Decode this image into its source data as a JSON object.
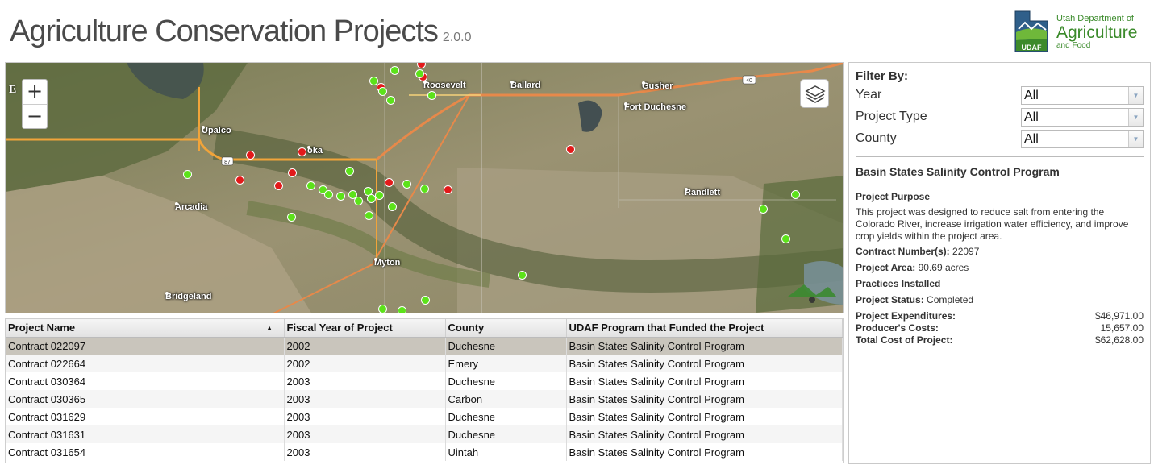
{
  "header": {
    "title": "Agriculture Conservation Projects",
    "version": "2.0.0",
    "logo": {
      "line1": "Utah Department of",
      "line2": "Agriculture",
      "line3": "and Food",
      "badge": "UDAF"
    }
  },
  "map": {
    "zoom_in": "+",
    "zoom_out": "−",
    "edge_letter": "E",
    "places": {
      "roosevelt": "Roosevelt",
      "ballard": "Ballard",
      "gusher": "Gusher",
      "fort_duchesne": "Fort Duchesne",
      "upalco": "Upalco",
      "ioka": "oka",
      "arcadia": "Arcadia",
      "randlett": "Randlett",
      "myton": "Myton",
      "bridgeland": "Bridgeland"
    },
    "road_labels": {
      "hwy87": "87",
      "hwy40": "40"
    },
    "colors": {
      "active_point": "#5ce21a",
      "alert_point": "#e21a1a"
    }
  },
  "table": {
    "columns": [
      "Project Name",
      "Fiscal Year of Project",
      "County",
      "UDAF Program that Funded the Project"
    ],
    "rows": [
      [
        "Contract 022097",
        "2002",
        "Duchesne",
        "Basin States Salinity Control Program"
      ],
      [
        "Contract 022664",
        "2002",
        "Emery",
        "Basin States Salinity Control Program"
      ],
      [
        "Contract 030364",
        "2003",
        "Duchesne",
        "Basin States Salinity Control Program"
      ],
      [
        "Contract 030365",
        "2003",
        "Carbon",
        "Basin States Salinity Control Program"
      ],
      [
        "Contract 031629",
        "2003",
        "Duchesne",
        "Basin States Salinity Control Program"
      ],
      [
        "Contract 031631",
        "2003",
        "Duchesne",
        "Basin States Salinity Control Program"
      ],
      [
        "Contract 031654",
        "2003",
        "Uintah",
        "Basin States Salinity Control Program"
      ]
    ]
  },
  "filters": {
    "title": "Filter By:",
    "year": {
      "label": "Year",
      "value": "All"
    },
    "project_type": {
      "label": "Project Type",
      "value": "All"
    },
    "county": {
      "label": "County",
      "value": "All"
    }
  },
  "details": {
    "program": "Basin States Salinity Control Program",
    "purpose_heading": "Project Purpose",
    "purpose_text": "This project was designed to reduce salt from entering the Colorado River, increase irrigation water efficiency, and improve crop yields within the project area.",
    "contract_label": "Contract Number(s):",
    "contract_value": "22097",
    "area_label": "Project Area:",
    "area_value": "90.69 acres",
    "practices_heading": "Practices Installed",
    "status_label": "Project Status:",
    "status_value": "Completed",
    "expenditures_label": "Project Expenditures:",
    "expenditures_value": "$46,971.00",
    "producer_label": "Producer's Costs:",
    "producer_value": "15,657.00",
    "total_label": "Total Cost of Project:",
    "total_value": "$62,628.00"
  }
}
